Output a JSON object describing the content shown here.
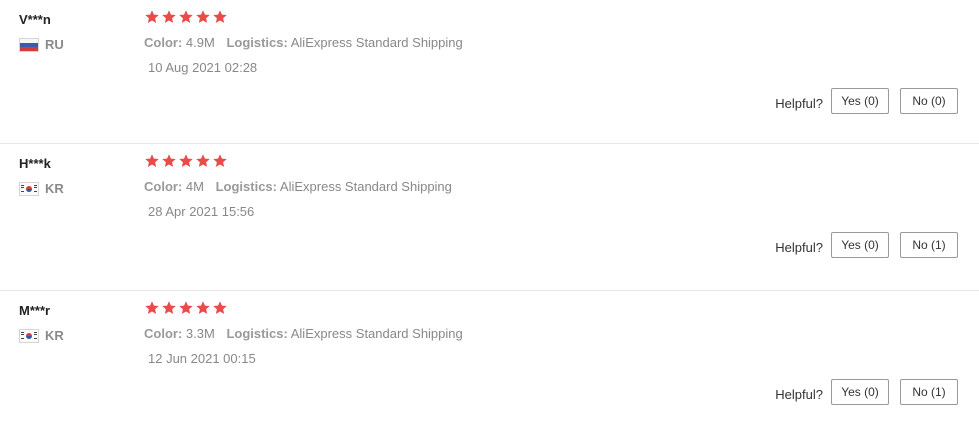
{
  "helpful_label": "Helpful?",
  "star_color": "#e94a4a",
  "reviews": [
    {
      "user": "V***n",
      "country": "RU",
      "flag_icon": "russia-flag-icon",
      "rating": 5,
      "color_label": "Color:",
      "color_value": "4.9M",
      "logistics_label": "Logistics:",
      "logistics_value": "AliExpress Standard Shipping",
      "date": "10 Aug 2021 02:28",
      "yes_label": "Yes (0)",
      "no_label": "No (0)"
    },
    {
      "user": "H***k",
      "country": "KR",
      "flag_icon": "korea-flag-icon",
      "rating": 5,
      "color_label": "Color:",
      "color_value": "4M",
      "logistics_label": "Logistics:",
      "logistics_value": "AliExpress Standard Shipping",
      "date": "28 Apr 2021 15:56",
      "yes_label": "Yes (0)",
      "no_label": "No (1)"
    },
    {
      "user": "M***r",
      "country": "KR",
      "flag_icon": "korea-flag-icon",
      "rating": 5,
      "color_label": "Color:",
      "color_value": "3.3M",
      "logistics_label": "Logistics:",
      "logistics_value": "AliExpress Standard Shipping",
      "date": "12 Jun 2021 00:15",
      "yes_label": "Yes (0)",
      "no_label": "No (1)"
    }
  ]
}
